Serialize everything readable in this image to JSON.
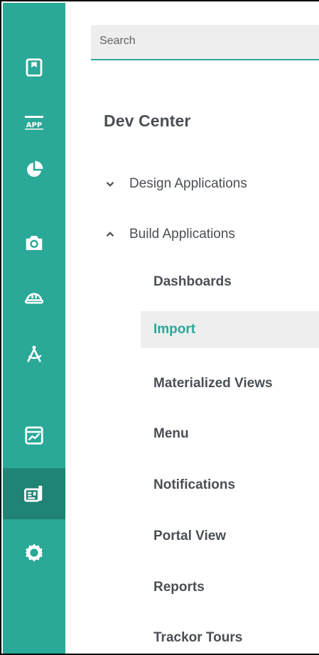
{
  "search": {
    "placeholder": "Search"
  },
  "main": {
    "title": "Dev Center"
  },
  "groups": [
    {
      "label": "Design Applications",
      "expanded": false,
      "icon": "chevron-down-icon"
    },
    {
      "label": "Build Applications",
      "expanded": true,
      "icon": "chevron-up-icon"
    }
  ],
  "build_items": [
    {
      "label": "Dashboards",
      "active": false
    },
    {
      "label": "Import",
      "active": true
    },
    {
      "label": "Materialized Views",
      "active": false
    },
    {
      "label": "Menu",
      "active": false
    },
    {
      "label": "Notifications",
      "active": false
    },
    {
      "label": "Portal View",
      "active": false
    },
    {
      "label": "Reports",
      "active": false
    },
    {
      "label": "Trackor Tours",
      "active": false
    }
  ],
  "rail": {
    "items": [
      {
        "icon": "bookmark-board-icon"
      },
      {
        "icon": "app-icon",
        "text": "APP"
      },
      {
        "icon": "pie-chart-icon"
      },
      {
        "icon": "camera-icon"
      },
      {
        "icon": "hard-hat-icon"
      },
      {
        "icon": "compass-drafting-icon"
      },
      {
        "icon": "line-chart-icon"
      },
      {
        "icon": "dev-center-icon",
        "active": true
      },
      {
        "icon": "gear-icon"
      }
    ]
  },
  "colors": {
    "accent": "#2aa898",
    "rail_active": "#1f8474",
    "text": "#4a4f55",
    "highlight_bg": "#eeeeee"
  }
}
